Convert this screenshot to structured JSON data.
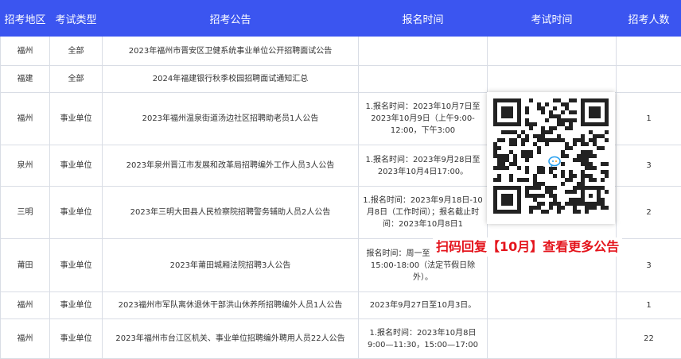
{
  "header": {
    "region": "招考地区",
    "type": "考试类型",
    "notice": "招考公告",
    "signup_time": "报名时间",
    "exam_time": "考试时间",
    "count": "招考人数"
  },
  "rows": [
    {
      "region": "福州",
      "type": "全部",
      "notice": "2023年福州市晋安区卫健系统事业单位公开招聘面试公告",
      "signup": "",
      "exam": "",
      "count": ""
    },
    {
      "region": "福建",
      "type": "全部",
      "notice": "2024年福建银行秋季校园招聘面试通知汇总",
      "signup": "",
      "exam": "",
      "count": ""
    },
    {
      "region": "福州",
      "type": "事业单位",
      "notice": "2023年福州温泉街道汤边社区招聘助老员1人公告",
      "signup": "1.报名时间：2023年10月7日至2023年10月9日（上午9:00-12:00，下午3:00",
      "exam": "",
      "count": "1"
    },
    {
      "region": "泉州",
      "type": "事业单位",
      "notice": "2023年泉州晋江市发展和改革局招聘编外工作人员3人公告",
      "signup": "1.报名时间：2023年9月28日至2023年10月4日17:00。",
      "exam": "",
      "count": "3"
    },
    {
      "region": "三明",
      "type": "事业单位",
      "notice": "2023年三明大田县人民检察院招聘警务辅助人员2人公告",
      "signup": "1.报名时间：2023年9月18日-10月8日（工作时间）；报名截止时间：2023年10月8日1",
      "exam": "",
      "count": "2"
    },
    {
      "region": "莆田",
      "type": "事业单位",
      "notice": "2023年莆田城厢法院招聘3人公告",
      "signup": "报名时间：周一至 12:00，下午15:00-18:00（法定节假日除外）。",
      "exam": "",
      "count": "3"
    },
    {
      "region": "福州",
      "type": "事业单位",
      "notice": "2023福州市军队离休退休干部洪山休养所招聘编外人员1人公告",
      "signup": "2023年9月27日至10月3日。",
      "exam": "",
      "count": "1"
    },
    {
      "region": "福州",
      "type": "事业单位",
      "notice": "2023年福州市台江区机关、事业单位招聘编外聘用人员22人公告",
      "signup": "1.报名时间：2023年10月8日9:00—11:30，15:00—17:00",
      "exam": "",
      "count": "22"
    }
  ],
  "overlay": {
    "qr_label": "qr-code",
    "banner": "扫码回复【10月】查看更多公告",
    "accent": "#e4141c",
    "header_color": "#3b55f0"
  }
}
